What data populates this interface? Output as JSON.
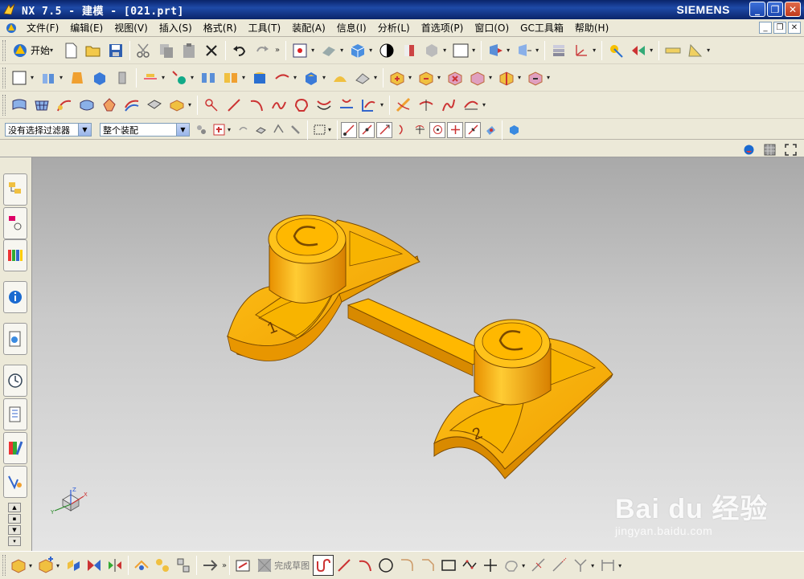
{
  "window": {
    "title": "NX 7.5 - 建模 - [021.prt]",
    "brand": "SIEMENS",
    "buttons": [
      "_",
      "❐",
      "✕"
    ]
  },
  "menu": {
    "items": [
      "文件(F)",
      "编辑(E)",
      "视图(V)",
      "插入(S)",
      "格式(R)",
      "工具(T)",
      "装配(A)",
      "信息(I)",
      "分析(L)",
      "首选项(P)",
      "窗口(O)",
      "GC工具箱",
      "帮助(H)"
    ],
    "doc_buttons": [
      "_",
      "❐",
      "✕"
    ]
  },
  "toolbar": {
    "start_label": "开始",
    "start_arrow": "▾",
    "more": "»"
  },
  "selection_bar": {
    "filter_value": "没有选择过滤器",
    "scope_value": "整个装配"
  },
  "viewport": {
    "model_label_1": "1",
    "model_label_2": "2",
    "model_color": "#f5a800",
    "triad_x": "X",
    "triad_y": "Y",
    "triad_z": "Z"
  },
  "bottom_toolbar": {
    "finish_sketch_label": "完成草图"
  },
  "watermark": {
    "logo": "Bai du 经验",
    "url": "jingyan.baidu.com"
  }
}
